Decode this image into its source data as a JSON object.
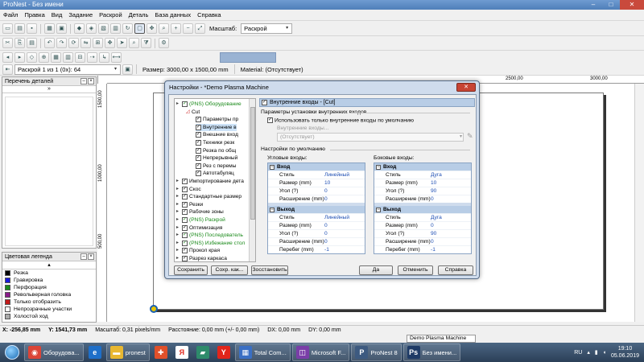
{
  "window": {
    "title": "ProNest - Без имени"
  },
  "menu": [
    "Файл",
    "Правка",
    "Вид",
    "Задание",
    "Раскрой",
    "Деталь",
    "База данных",
    "Справка"
  ],
  "toolbar1": {
    "scale_label": "Масштаб:",
    "scale_value": "Раскрой"
  },
  "toolbar3": {
    "nest_select": "Раскрой 1 из 1 (0x): 64",
    "size": "Размер: 3000,00 x 1500,00 mm",
    "material": "Material: (Отсутствует)"
  },
  "panels": {
    "parts_title": "Перечень деталей",
    "legend_title": "Цветовая легенда",
    "legend": [
      {
        "label": "Резка",
        "color": "#000000"
      },
      {
        "label": "Гравировка",
        "color": "#1a1adb"
      },
      {
        "label": "Перфорация",
        "color": "#1a8a1a"
      },
      {
        "label": "Револьверная головка",
        "color": "#8a1a8a"
      },
      {
        "label": "Только отобразить",
        "color": "#c41a1a"
      },
      {
        "label": "Непрозрачные участки",
        "color": "#ffffff"
      },
      {
        "label": "Холостой ход",
        "color": "#aaaaaa"
      }
    ]
  },
  "rulers": {
    "h": [
      "2500,00",
      "3000,00"
    ],
    "v": [
      "1500,00",
      "1000,00",
      "500,00"
    ]
  },
  "status": {
    "x": "X: -256,85 mm",
    "y": "Y: 1541,73 mm",
    "scale": "Масштаб: 0,31 pixels/mm",
    "distance": "Расстояние: 0,00 mm (+/- 0,00 mm)",
    "dx": "DX: 0,00 mm",
    "dy": "DY: 0,00 mm"
  },
  "dialog": {
    "title": "Настройки - *Demo Plasma Machine",
    "tree": [
      "(PNS) Оборудование",
      "Cut",
      "Параметры пр",
      "Внутренние в",
      "Внешние вход",
      "Техники резк",
      "Резка по общ",
      "Непрерывный",
      "Рез с перемы",
      "Автотабуляц",
      "Импортирование дета",
      "Скос",
      "Стандартные размер",
      "Резки",
      "Рабочие зоны",
      "(PNS) Раскрой",
      "Оптимизация",
      "(PNS) Последователь",
      "(PNS) Избежание стол",
      "Прокол края",
      "Разрез каркаса"
    ],
    "header": "Внутренние входы - [Cut]",
    "params_title": "Параметры установки внутренних входов",
    "use_only_default": "Использовать только внутренние входы по умолчанию",
    "inner_leads_label": "Внутренние входы...",
    "inner_leads_value": "(Отсутствует)",
    "defaults_title": "Настройки по умолчанию",
    "corner_title": "Угловые входы:",
    "side_title": "Боковые входы:",
    "corner": {
      "entry_title": "Вход",
      "entry": [
        {
          "k": "Стиль",
          "v": "Линейный"
        },
        {
          "k": "Размер (mm)",
          "v": "10"
        },
        {
          "k": "Угол (?)",
          "v": "0"
        },
        {
          "k": "Расширение (mm)",
          "v": "0"
        }
      ],
      "exit_title": "Выход",
      "exit": [
        {
          "k": "Стиль",
          "v": "Линейный"
        },
        {
          "k": "Размер (mm)",
          "v": "0"
        },
        {
          "k": "Угол (?)",
          "v": "0"
        },
        {
          "k": "Расширение (mm)",
          "v": "0"
        },
        {
          "k": "Перебег (mm)",
          "v": "-1"
        }
      ]
    },
    "side": {
      "entry_title": "Вход",
      "entry": [
        {
          "k": "Стиль",
          "v": "Дуга"
        },
        {
          "k": "Размер (mm)",
          "v": "10"
        },
        {
          "k": "Угол (?)",
          "v": "90"
        },
        {
          "k": "Расширение (mm)",
          "v": "0"
        }
      ],
      "exit_title": "Выход",
      "exit": [
        {
          "k": "Стиль",
          "v": "Дуга"
        },
        {
          "k": "Размер (mm)",
          "v": "0"
        },
        {
          "k": "Угол (?)",
          "v": "90"
        },
        {
          "k": "Расширение (mm)",
          "v": "0"
        },
        {
          "k": "Перебег (mm)",
          "v": "-1"
        }
      ]
    },
    "buttons": {
      "save": "Сохранить",
      "save_as": "Сохр. как...",
      "restore": "Зосстановить",
      "ok": "Да",
      "cancel": "Отменить",
      "help": "Справка"
    }
  },
  "taskbar": {
    "preview": "Demo Plasma Machine",
    "items": [
      {
        "label": "Оборудова...",
        "color": "#db4437",
        "glyph": "◉"
      },
      {
        "label": "",
        "color": "#1e6fc9",
        "glyph": "e"
      },
      {
        "label": "pronest",
        "color": "#e8b731",
        "glyph": "▬"
      },
      {
        "label": "",
        "color": "#e0502a",
        "glyph": "✚"
      },
      {
        "label": "",
        "color": "#ffffff",
        "glyph": "Я"
      },
      {
        "label": "",
        "color": "#2e8b6b",
        "glyph": "▰"
      },
      {
        "label": "",
        "color": "#e1251b",
        "glyph": "Y"
      },
      {
        "label": "Total Com...",
        "color": "#3a6fc4",
        "glyph": "▦"
      },
      {
        "label": "Microsoft F...",
        "color": "#7a3ea8",
        "glyph": "◫"
      },
      {
        "label": "ProNest 8",
        "color": "#3d5a80",
        "glyph": "P"
      },
      {
        "label": "Без имени...",
        "color": "#1f3b66",
        "glyph": "Ps"
      }
    ],
    "lang": "RU",
    "time": "19:10",
    "date": "05.06.2019"
  }
}
